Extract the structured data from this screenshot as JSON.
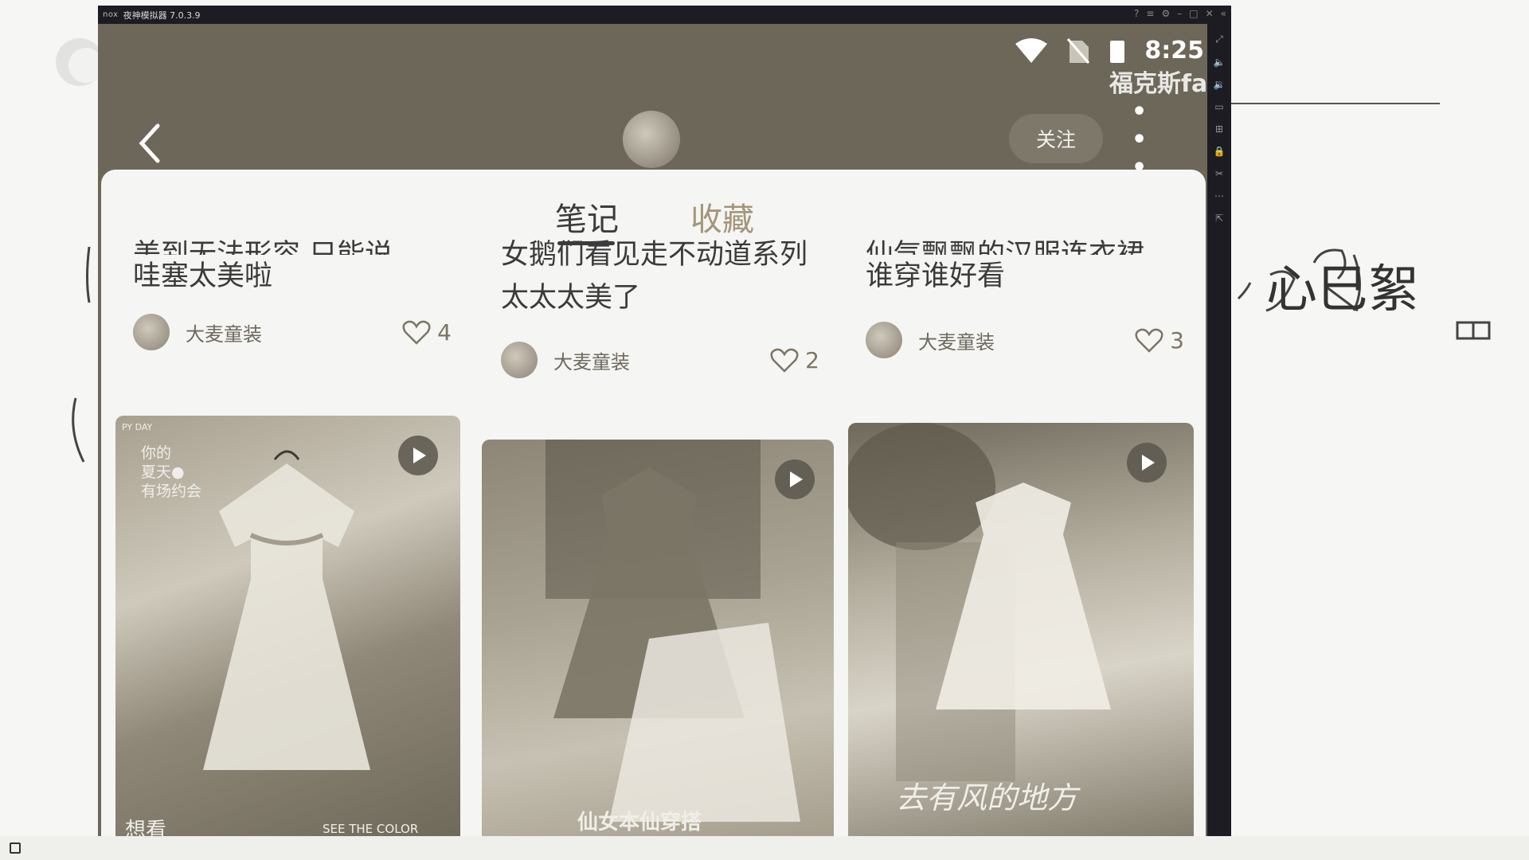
{
  "emulator": {
    "title": "夜神模拟器 7.0.3.9",
    "brand": "nox"
  },
  "status": {
    "time": "8:25"
  },
  "watermark": "福克斯fa",
  "header": {
    "follow_label": "关注",
    "more_label": "• • •"
  },
  "tabs": [
    {
      "label": "笔记",
      "active": true
    },
    {
      "label": "收藏",
      "active": false
    }
  ],
  "notes": [
    {
      "title_cut": "美到无法形容 只能说",
      "title": "哇塞太美啦",
      "author": "大麦童装",
      "likes": "4",
      "overlay_top": "你的\n夏天●\n有场约会",
      "overlay_day": "PY DAY",
      "overlay_bottom_left": "想看",
      "overlay_bottom_right": "SEE THE COLOR"
    },
    {
      "title": "女鹅们看见走不动道系列 太太太美了",
      "author": "大麦童装",
      "likes": "2",
      "overlay_bottom": "仙女本仙穿搭"
    },
    {
      "title_cut": "仙气飘飘的汉服连衣裙",
      "title": "谁穿谁好看",
      "author": "大麦童装",
      "likes": "3",
      "overlay_bottom": "去有风的地方"
    }
  ],
  "whiteboard": {
    "scribble": "心巳絮"
  }
}
